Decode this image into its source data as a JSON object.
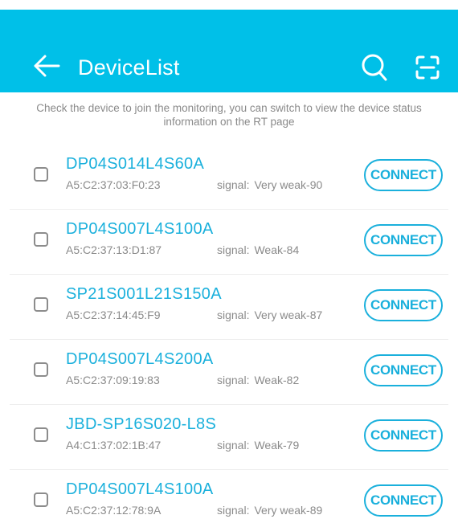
{
  "header": {
    "title": "DeviceList",
    "back_icon": "arrow-left-icon",
    "search_icon": "search-icon",
    "scan_icon": "scan-icon",
    "background_color": "#00c0e8"
  },
  "hint": "Check the device to join the monitoring, you can switch to view the device status information on the RT page",
  "signal_label": "signal:",
  "connect_label": "CONNECT",
  "accent_color": "#1ab0dc",
  "devices": [
    {
      "name": "DP04S014L4S60A",
      "mac": "A5:C2:37:03:F0:23",
      "signal": "Very weak-90",
      "checked": false
    },
    {
      "name": "DP04S007L4S100A",
      "mac": "A5:C2:37:13:D1:87",
      "signal": "Weak-84",
      "checked": false
    },
    {
      "name": "SP21S001L21S150A",
      "mac": "A5:C2:37:14:45:F9",
      "signal": "Very weak-87",
      "checked": false
    },
    {
      "name": "DP04S007L4S200A",
      "mac": "A5:C2:37:09:19:83",
      "signal": "Weak-82",
      "checked": false
    },
    {
      "name": "JBD-SP16S020-L8S",
      "mac": "A4:C1:37:02:1B:47",
      "signal": "Weak-79",
      "checked": false
    },
    {
      "name": "DP04S007L4S100A",
      "mac": "A5:C2:37:12:78:9A",
      "signal": "Very weak-89",
      "checked": false
    }
  ]
}
